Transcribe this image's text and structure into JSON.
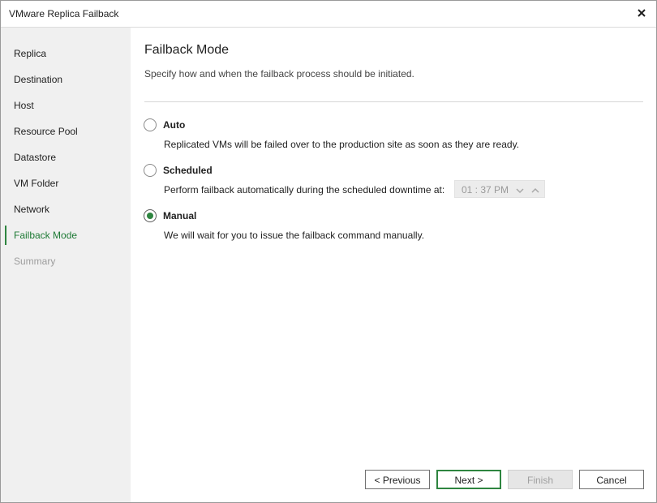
{
  "window": {
    "title": "VMware Replica Failback"
  },
  "sidebar": {
    "items": [
      {
        "label": "Replica",
        "state": "normal"
      },
      {
        "label": "Destination",
        "state": "normal"
      },
      {
        "label": "Host",
        "state": "normal"
      },
      {
        "label": "Resource Pool",
        "state": "normal"
      },
      {
        "label": "Datastore",
        "state": "normal"
      },
      {
        "label": "VM Folder",
        "state": "normal"
      },
      {
        "label": "Network",
        "state": "normal"
      },
      {
        "label": "Failback Mode",
        "state": "active"
      },
      {
        "label": "Summary",
        "state": "disabled"
      }
    ]
  },
  "main": {
    "title": "Failback Mode",
    "description": "Specify how and when the failback process should be initiated.",
    "options": [
      {
        "label": "Auto",
        "description": "Replicated VMs will be failed over to the production site as soon as they are ready.",
        "checked": false
      },
      {
        "label": "Scheduled",
        "description": "Perform failback automatically during the scheduled downtime at:",
        "checked": false
      },
      {
        "label": "Manual",
        "description": "We will wait for you to issue the failback command manually.",
        "checked": true
      }
    ],
    "scheduled_time": "01 : 37  PM"
  },
  "footer": {
    "previous_label": "< Previous",
    "next_label": "Next >",
    "finish_label": "Finish",
    "cancel_label": "Cancel"
  },
  "colors": {
    "accent": "#2e8540",
    "sidebar_bg": "#f0f0f0"
  }
}
